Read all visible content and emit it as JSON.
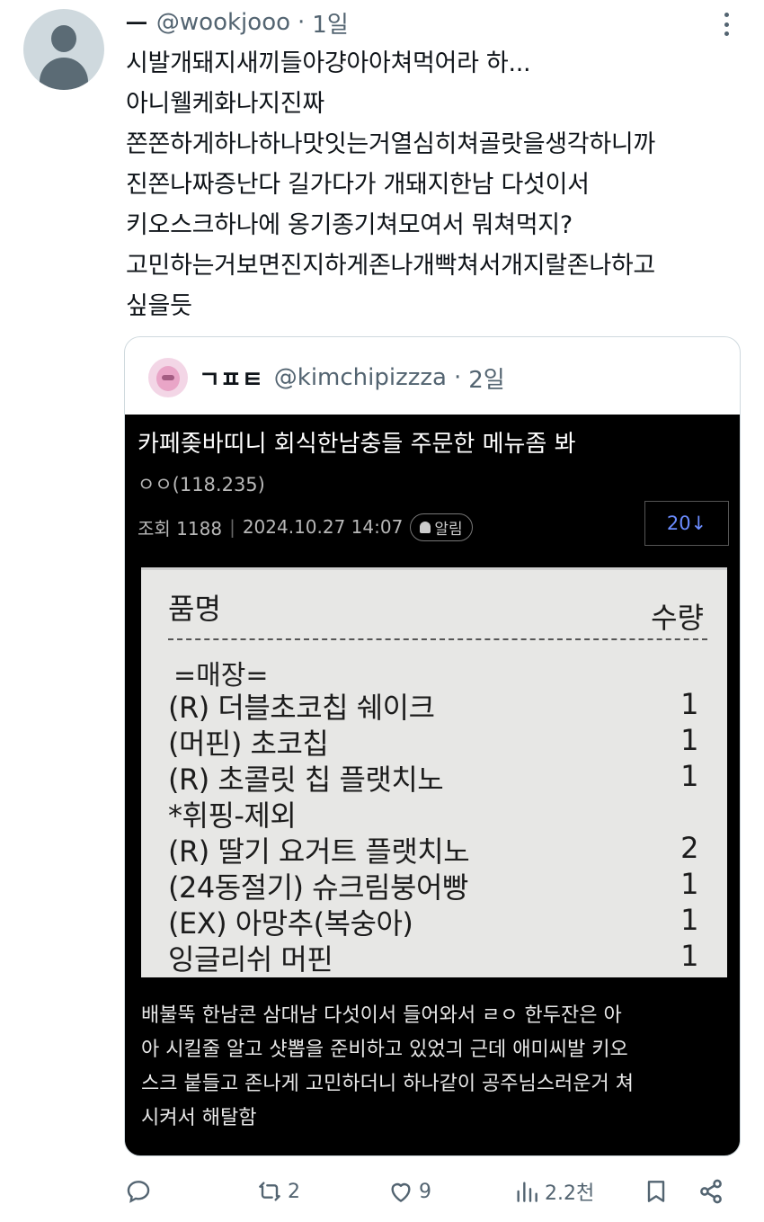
{
  "tweet": {
    "display_name": "ㅡ",
    "handle": "@wookjooo",
    "separator": "·",
    "time": "1일",
    "text": "시발개돼지새끼들아걍아아쳐먹어라 하...\n아니웰케화나지진짜\n쫀쫀하게하나하나맛잇는거열심히쳐골랏을생각하니까\n진쫀나짜증난다 길가다가 개돼지한남 다섯이서\n키오스크하나에 옹기종기쳐모여서 뭐쳐먹지?\n고민하는거보면진지하게존나개빡쳐서개지랄존나하고\n싶을듯"
  },
  "quote": {
    "display_name": "ㄱㅍㅌ",
    "handle": "@kimchipizzza",
    "separator": "·",
    "time": "2일",
    "post": {
      "title": "카페좆바띠니 회식한남충들 주문한 메뉴좀 봐",
      "author": "ㅇㅇ(118.235)",
      "views": "조회 1188",
      "date": "2024.10.27 14:07",
      "alarm": "알림",
      "comments": "20↓",
      "body": "배불뚝 한남콘 삼대남 다섯이서 들어와서 ㄹㅇ 한두잔은 아\n아 시킬줄 알고 샷뽑을 준비하고 있었긔 근데 애미씨발 키오\n스크 붙들고 존나게 고민하더니 하나같이 공주님스러운거 쳐\n시켜서 해탈함"
    },
    "receipt": {
      "col_name": "품명",
      "col_qty": "수량",
      "section": "=매장=",
      "rows": [
        {
          "name": "(R) 더블초코칩 쉐이크",
          "qty": "1"
        },
        {
          "name": "(머핀) 초코칩",
          "qty": "1"
        },
        {
          "name": "(R) 초콜릿 칩 플랫치노",
          "qty": "1"
        },
        {
          "name": "  *휘핑-제외",
          "qty": ""
        },
        {
          "name": "(R) 딸기 요거트 플랫치노",
          "qty": "2"
        },
        {
          "name": "(24동절기) 슈크림붕어빵",
          "qty": "1"
        },
        {
          "name": "(EX) 아망추(복숭아)",
          "qty": "1"
        },
        {
          "name": "잉글리쉬 머핀",
          "qty": "1"
        }
      ]
    }
  },
  "actions": {
    "reply": "",
    "retweet": "2",
    "like": "9",
    "views": "2.2천"
  }
}
